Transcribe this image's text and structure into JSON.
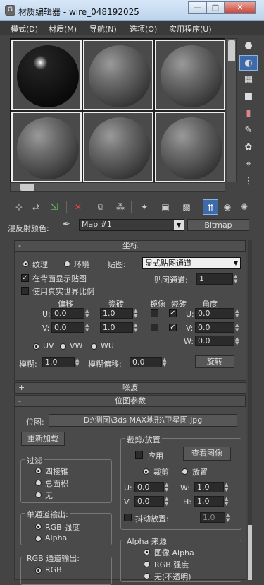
{
  "window": {
    "title": "材质编辑器 - wire_048192025",
    "icon": "G",
    "min": "—",
    "max": "□",
    "close": "✕"
  },
  "menu": [
    "模式(D)",
    "材质(M)",
    "导航(N)",
    "选项(O)",
    "实用程序(U)"
  ],
  "toolbar": {
    "diffuse_label": "漫反射颜色:",
    "map_name": "Map #1",
    "map_type": "Bitmap"
  },
  "coords": {
    "title": "坐标",
    "texture": "纹理",
    "environ": "环境",
    "mapping_label": "贴图:",
    "mapping_value": "显式贴图通道",
    "show_back": "在背面显示贴图",
    "real_world": "使用真实世界比例",
    "map_channel_label": "贴图通道:",
    "map_channel": "1",
    "offset": "偏移",
    "tiling": "瓷砖",
    "mirror": "镜像",
    "tile": "瓷砖",
    "angle": "角度",
    "u": "U:",
    "v": "V:",
    "w": "W:",
    "u_offset": "0.0",
    "v_offset": "0.0",
    "u_tiling": "1.0",
    "v_tiling": "1.0",
    "u_angle": "0.0",
    "v_angle": "0.0",
    "w_angle": "0.0",
    "uv": "UV",
    "vw": "VW",
    "wu": "WU",
    "blur_label": "模糊:",
    "blur": "1.0",
    "blur_offset_label": "模糊偏移:",
    "blur_offset": "0.0",
    "rotate": "旋转"
  },
  "noise": {
    "title": "噪波",
    "sign": "+"
  },
  "bitmap": {
    "title": "位图参数",
    "sign": "-",
    "path_label": "位图:",
    "path": "D:\\测图\\3ds MAX地形\\卫星图.jpg",
    "reload": "重新加载",
    "filter_title": "过滤",
    "pyramidal": "四棱锥",
    "summed": "总面积",
    "none": "无",
    "mono_title": "单通道输出:",
    "rgb_intensity": "RGB 强度",
    "alpha": "Alpha",
    "rgb_out_title": "RGB 通道输出:",
    "rgb": "RGB",
    "crop_title": "裁剪/放置",
    "apply": "应用",
    "view_image": "查看图像",
    "crop": "裁剪",
    "place": "放置",
    "u_val": "0.0",
    "v_val": "0.0",
    "w_val": "1.0",
    "h_val": "1.0",
    "jitter": "抖动放置:",
    "jitter_val": "1.0",
    "alpha_source_title": "Alpha 来源",
    "image_alpha": "图像 Alpha",
    "rgb_intensity2": "RGB 强度",
    "none_opaque": "无(不透明)",
    "W": "W:",
    "H": "H:"
  }
}
